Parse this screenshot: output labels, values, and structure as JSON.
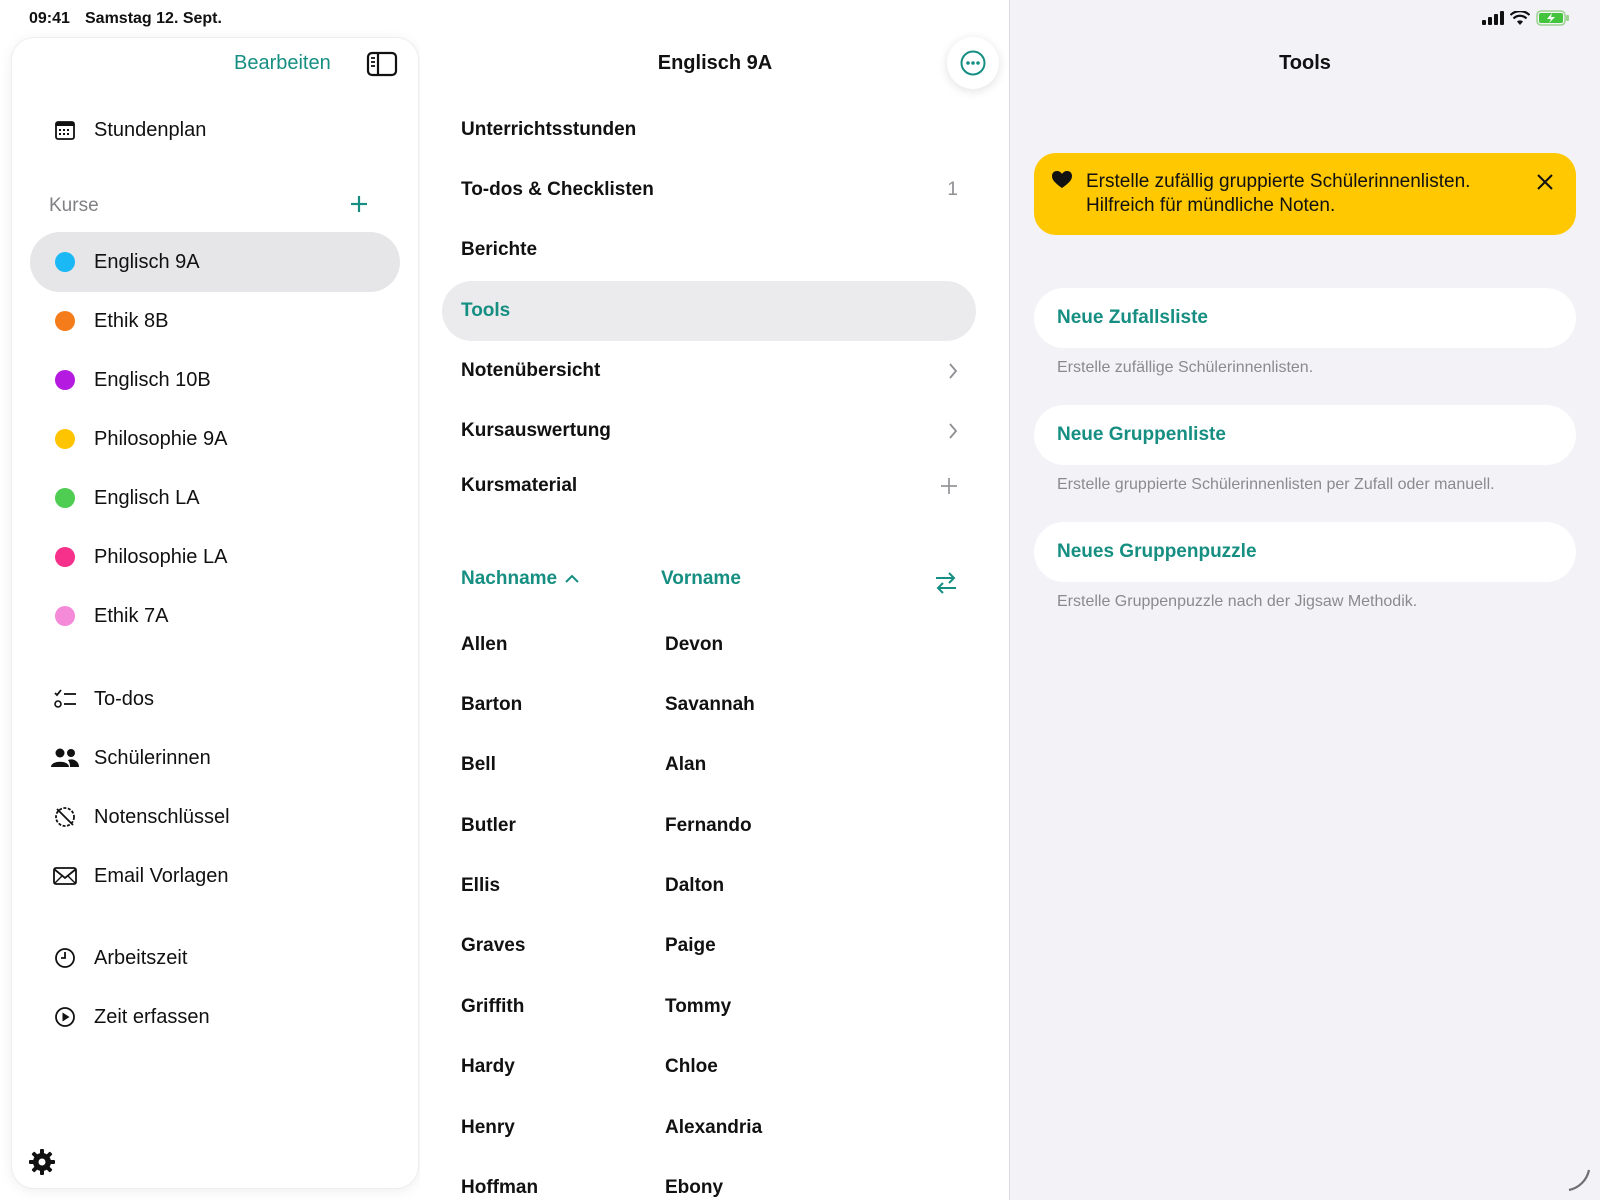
{
  "status": {
    "time": "09:41",
    "date": "Samstag 12. Sept."
  },
  "sidebar": {
    "edit_label": "Bearbeiten",
    "nav_top": {
      "label": "Stundenplan",
      "icon": "calendar-icon"
    },
    "courses_header": "Kurse",
    "courses": [
      {
        "label": "Englisch 9A",
        "color": "#1ab8f5",
        "selected": true
      },
      {
        "label": "Ethik 8B",
        "color": "#f57c1a"
      },
      {
        "label": "Englisch 10B",
        "color": "#b51ae0"
      },
      {
        "label": "Philosophie 9A",
        "color": "#ffc400"
      },
      {
        "label": "Englisch LA",
        "color": "#4fcc52"
      },
      {
        "label": "Philosophie LA",
        "color": "#f5318c"
      },
      {
        "label": "Ethik 7A",
        "color": "#f58ad8"
      }
    ],
    "nav": [
      {
        "label": "To-dos",
        "icon": "checklist-icon"
      },
      {
        "label": "Schülerinnen",
        "icon": "people-icon"
      },
      {
        "label": "Notenschlüssel",
        "icon": "grade-key-icon"
      },
      {
        "label": "Email Vorlagen",
        "icon": "envelope-icon"
      }
    ],
    "nav_bottom": [
      {
        "label": "Arbeitszeit",
        "icon": "clock-icon"
      },
      {
        "label": "Zeit erfassen",
        "icon": "play-icon"
      }
    ]
  },
  "middle": {
    "title": "Englisch 9A",
    "menu": [
      {
        "label": "Unterrichtsstunden"
      },
      {
        "label": "To-dos & Checklisten",
        "trail": "1"
      },
      {
        "label": "Berichte"
      },
      {
        "label": "Tools",
        "selected": true
      },
      {
        "label": "Notenübersicht",
        "trail_icon": "chevron-right-icon"
      },
      {
        "label": "Kursauswertung",
        "trail_icon": "chevron-right-icon"
      },
      {
        "label": "Kursmaterial",
        "trail_icon": "plus-icon"
      }
    ],
    "sort": {
      "lastname": "Nachname",
      "firstname": "Vorname"
    },
    "students": [
      {
        "last": "Allen",
        "first": "Devon"
      },
      {
        "last": "Barton",
        "first": "Savannah"
      },
      {
        "last": "Bell",
        "first": "Alan"
      },
      {
        "last": "Butler",
        "first": "Fernando"
      },
      {
        "last": "Ellis",
        "first": "Dalton"
      },
      {
        "last": "Graves",
        "first": "Paige"
      },
      {
        "last": "Griffith",
        "first": "Tommy"
      },
      {
        "last": "Hardy",
        "first": "Chloe"
      },
      {
        "last": "Henry",
        "first": "Alexandria"
      },
      {
        "last": "Hoffman",
        "first": "Ebony"
      }
    ]
  },
  "right": {
    "title": "Tools",
    "banner": {
      "line1": "Erstelle zufällig gruppierte Schülerinnenlisten.",
      "line2": "Hilfreich für mündliche Noten."
    },
    "tools": [
      {
        "label": "Neue Zufallsliste",
        "desc": "Erstelle zufällige Schülerinnenlisten."
      },
      {
        "label": "Neue Gruppenliste",
        "desc": "Erstelle gruppierte Schülerinnenlisten per Zufall oder manuell."
      },
      {
        "label": "Neues Gruppenpuzzle",
        "desc": "Erstelle Gruppenpuzzle nach der Jigsaw Methodik."
      }
    ]
  },
  "colors": {
    "accent": "#168f82",
    "banner": "#ffc800",
    "selected_bg": "#e6e6e8"
  }
}
